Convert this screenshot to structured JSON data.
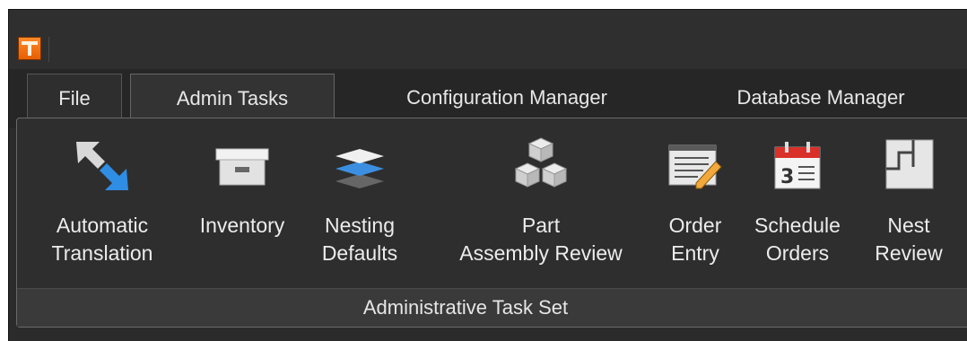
{
  "tabs": [
    {
      "label": "File"
    },
    {
      "label": "Admin Tasks",
      "active": true
    },
    {
      "label": "Configuration Manager"
    },
    {
      "label": "Database Manager"
    }
  ],
  "ribbon": {
    "group_label": "Administrative Task Set",
    "buttons": [
      {
        "line1": "Automatic",
        "line2": "Translation",
        "icon": "translation-arrows-icon"
      },
      {
        "line1": "Inventory",
        "line2": "",
        "icon": "storage-box-icon"
      },
      {
        "line1": "Nesting",
        "line2": "Defaults",
        "icon": "layers-icon"
      },
      {
        "line1": "Part",
        "line2": "Assembly Review",
        "icon": "cubes-icon"
      },
      {
        "line1": "Order",
        "line2": "Entry",
        "icon": "form-pencil-icon"
      },
      {
        "line1": "Schedule",
        "line2": "Orders",
        "icon": "calendar-icon"
      },
      {
        "line1": "Nest",
        "line2": "Review",
        "icon": "nest-sheet-icon"
      }
    ]
  },
  "colors": {
    "accent": "#f07a1a",
    "background": "#2b2b2b",
    "text": "#ececec",
    "calendar_red": "#d9302a"
  }
}
